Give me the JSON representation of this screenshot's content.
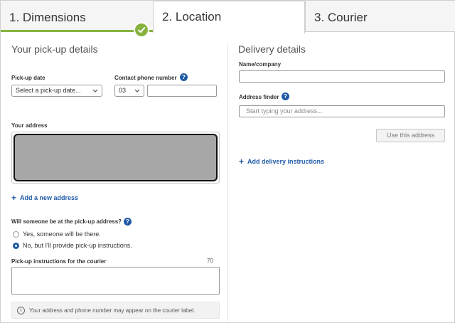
{
  "tabs": [
    {
      "label": "1. Dimensions",
      "state": "completed"
    },
    {
      "label": "2. Location",
      "state": "active"
    },
    {
      "label": "3. Courier",
      "state": "upcoming"
    }
  ],
  "colors": {
    "accent_green": "#86b340",
    "link_blue": "#1f5aa6"
  },
  "pickup": {
    "heading": "Your pick-up details",
    "date_label": "Pick-up date",
    "date_select_value": "Select a pick-up date...",
    "phone_label": "Contact phone number",
    "phone_prefix_value": "03",
    "phone_number_value": "",
    "address_label": "Your address",
    "add_address_link": "Add a new address",
    "presence_question": "Will someone be at the pick-up address?",
    "presence_options": [
      {
        "label": "Yes, someone will be there.",
        "selected": false
      },
      {
        "label": "No, but I'll provide pick-up instructions.",
        "selected": true
      }
    ],
    "instructions_label": "Pick-up instructions for the courier",
    "instructions_counter": "70",
    "instructions_value": "",
    "notice_text": "Your address and phone number may appear on the courier label."
  },
  "delivery": {
    "heading": "Delivery details",
    "name_label": "Name/company",
    "name_value": "",
    "finder_label": "Address finder",
    "finder_placeholder": "Start typing your address...",
    "use_address_button": "Use this address",
    "add_instructions_link": "Add delivery instructions"
  },
  "icons": [
    "checkmark-icon",
    "help-icon",
    "chevron-down-icon",
    "plus-icon",
    "info-icon"
  ]
}
